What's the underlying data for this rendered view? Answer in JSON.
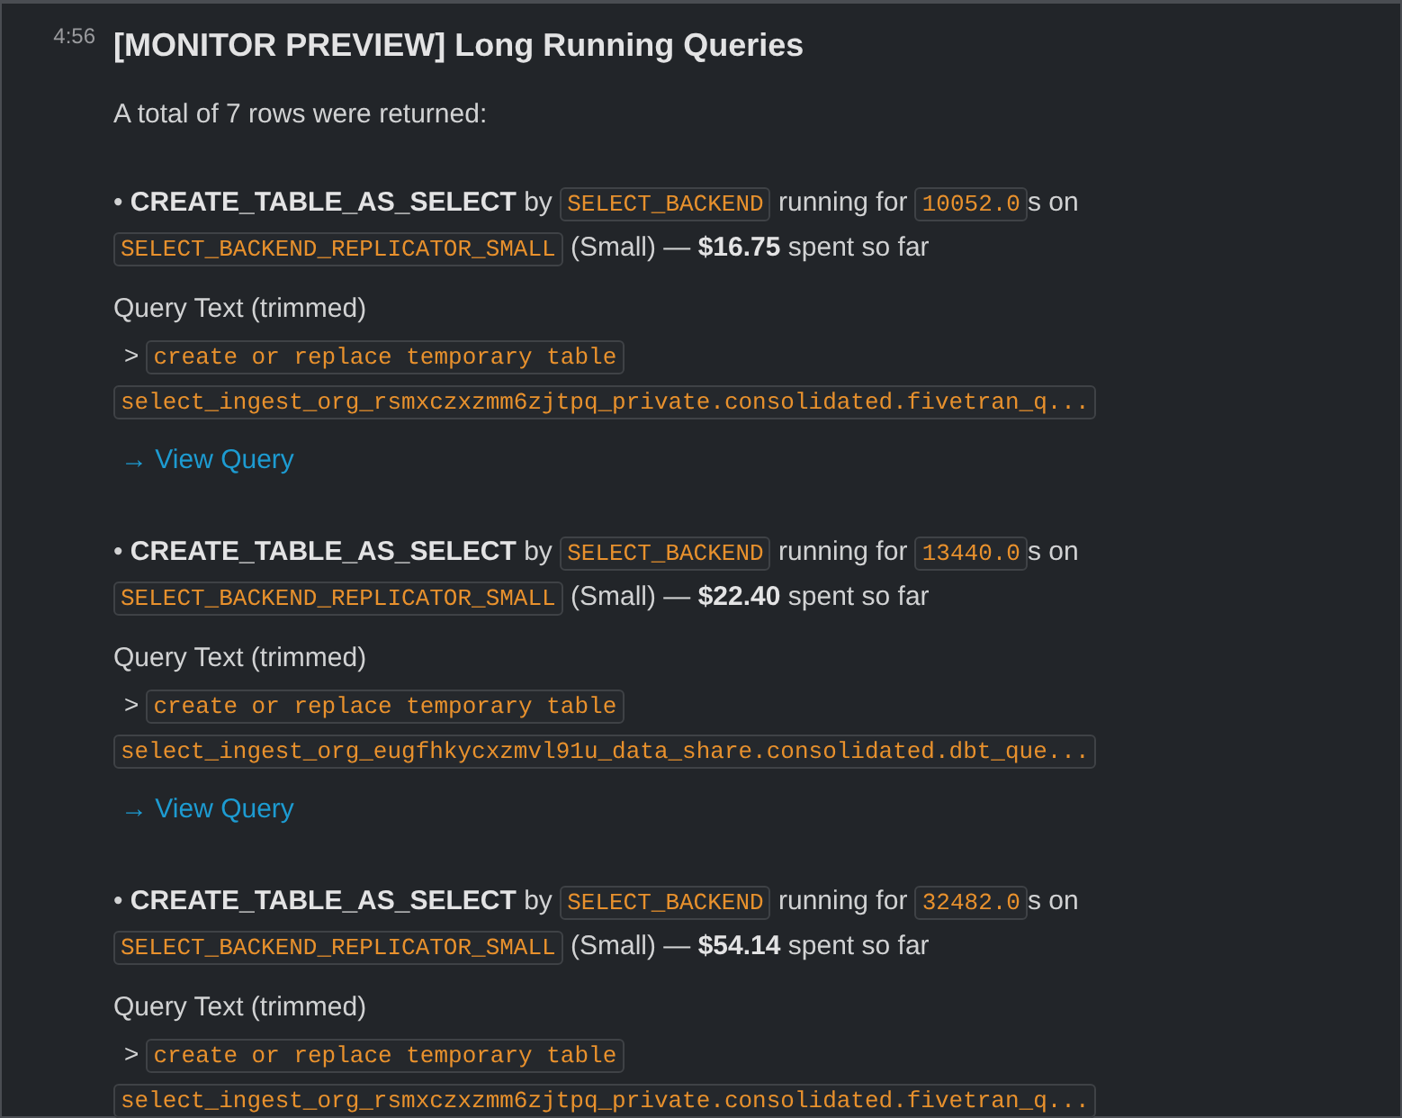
{
  "message": {
    "timestamp": "4:56",
    "title": "[MONITOR PREVIEW] Long Running Queries",
    "intro": "A total of 7 rows were returned:"
  },
  "queries": [
    {
      "summary": [
        {
          "kind": "plain",
          "text": "• "
        },
        {
          "kind": "bold",
          "text": "CREATE_TABLE_AS_SELECT"
        },
        {
          "kind": "plain",
          "text": " by "
        },
        {
          "kind": "code",
          "text": "SELECT_BACKEND"
        },
        {
          "kind": "plain",
          "text": " running for "
        },
        {
          "kind": "code",
          "text": "10052.0"
        },
        {
          "kind": "plain",
          "text": "s on "
        },
        {
          "kind": "code",
          "text": "SELECT_BACKEND_REPLICATOR_SMALL"
        },
        {
          "kind": "plain",
          "text": " (Small) — "
        },
        {
          "kind": "bold",
          "text": "$16.75"
        },
        {
          "kind": "plain",
          "text": " spent so far"
        }
      ],
      "text_label": "Query Text (trimmed)",
      "prompt": ">",
      "query_text": "create or replace temporary table select_ingest_org_rsmxczxzmm6zjtpq_private.consolidated.fivetran_q...",
      "link": "→ View Query"
    },
    {
      "summary": [
        {
          "kind": "plain",
          "text": "• "
        },
        {
          "kind": "bold",
          "text": "CREATE_TABLE_AS_SELECT"
        },
        {
          "kind": "plain",
          "text": " by "
        },
        {
          "kind": "code",
          "text": "SELECT_BACKEND"
        },
        {
          "kind": "plain",
          "text": " running for "
        },
        {
          "kind": "code",
          "text": "13440.0"
        },
        {
          "kind": "plain",
          "text": "s on "
        },
        {
          "kind": "code",
          "text": "SELECT_BACKEND_REPLICATOR_SMALL"
        },
        {
          "kind": "plain",
          "text": " (Small) — "
        },
        {
          "kind": "bold",
          "text": "$22.40"
        },
        {
          "kind": "plain",
          "text": " spent so far"
        }
      ],
      "text_label": "Query Text (trimmed)",
      "prompt": ">",
      "query_text": "create or replace temporary table select_ingest_org_eugfhkycxzmvl91u_data_share.consolidated.dbt_que...",
      "link": "→ View Query"
    },
    {
      "summary": [
        {
          "kind": "plain",
          "text": "• "
        },
        {
          "kind": "bold",
          "text": "CREATE_TABLE_AS_SELECT"
        },
        {
          "kind": "plain",
          "text": " by "
        },
        {
          "kind": "code",
          "text": "SELECT_BACKEND"
        },
        {
          "kind": "plain",
          "text": " running for "
        },
        {
          "kind": "code",
          "text": "32482.0"
        },
        {
          "kind": "plain",
          "text": "s on "
        },
        {
          "kind": "code",
          "text": "SELECT_BACKEND_REPLICATOR_SMALL"
        },
        {
          "kind": "plain",
          "text": " (Small) — "
        },
        {
          "kind": "bold",
          "text": "$54.14"
        },
        {
          "kind": "plain",
          "text": " spent so far"
        }
      ],
      "text_label": "Query Text (trimmed)",
      "prompt": ">",
      "query_text": "create or replace temporary table select_ingest_org_rsmxczxzmm6zjtpq_private.consolidated.fivetran_q..."
    }
  ]
}
